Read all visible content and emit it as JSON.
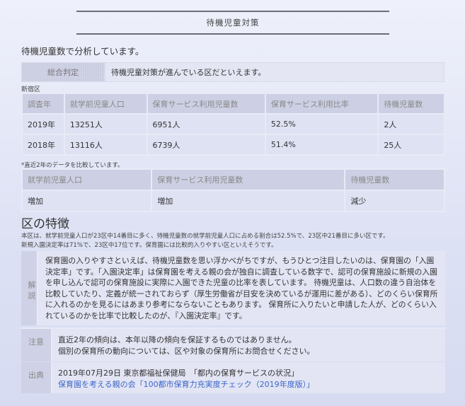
{
  "page_title": "待機児童対策",
  "lead": "待機児童数で分析しています。",
  "judgement": {
    "label": "総合判定",
    "value": "待機児童対策が進んでいる区だといえます。"
  },
  "ward": "新宿区",
  "stats": {
    "headers": [
      "調査年",
      "就学前児童人口",
      "保育サービス利用児童数",
      "保育サービス利用比率",
      "待機児童数"
    ],
    "rows": [
      [
        "2019年",
        "13251人",
        "6951人",
        "52.5%",
        "2人"
      ],
      [
        "2018年",
        "13116人",
        "6739人",
        "51.4%",
        "25人"
      ]
    ]
  },
  "compare_note": "*直近2年のデータを比較しています。",
  "trend": {
    "headers": [
      "就学前児童人口",
      "保育サービス利用児童数",
      "待機児童数"
    ],
    "values": [
      "増加",
      "増加",
      "減少"
    ]
  },
  "feature": {
    "title": "区の特徴",
    "line1": "本区は、就学前児童人口が23区中14番目に多く、待機児童数の就学前児童人口に占める割合は52.5%で、23区中21番目に多い区です。",
    "line2": "新規入園決定率は71%で、23区中17位です。保育園には比較的入りやすい区といえそうです。"
  },
  "explain": {
    "label": "解説",
    "text": "保育園の入りやすさといえば、待機児童数を思い浮かべがちですが、もうひとつ注目したいのは、保育園の「入園決定率」です。「入園決定率」は保育園を考える親の会が独自に調査している数字で、認可の保育施設に新規の入園を申し込んで認可の保育施設に実際に入園できた児童の比率を表しています。 待機児童は、人口数の違う自治体を比較していたり、定義が統一されておらず（厚生労働省が目安を決めているが運用に差がある）、どのくらい保育所に入れるのかを見るにはあまり参考にならないこともあります。 保育所に入りたいと申請した人が、どのくらい入れているのかを比率で比較したのが、『入園決定率』です。"
  },
  "caution": {
    "label": "注意",
    "line1": "直近2年の傾向は、本年以降の傾向を保証するものではありません。",
    "line2": "個別の保育所の動向については、区や対象の保育所にお問合せください。"
  },
  "source": {
    "label": "出典",
    "line1": "2019年07月29日 東京都福祉保健局　「都内の保育サービスの状況」",
    "link": "保育園を考える親の会「100都市保育力充実度チェック（2019年度版）」"
  }
}
